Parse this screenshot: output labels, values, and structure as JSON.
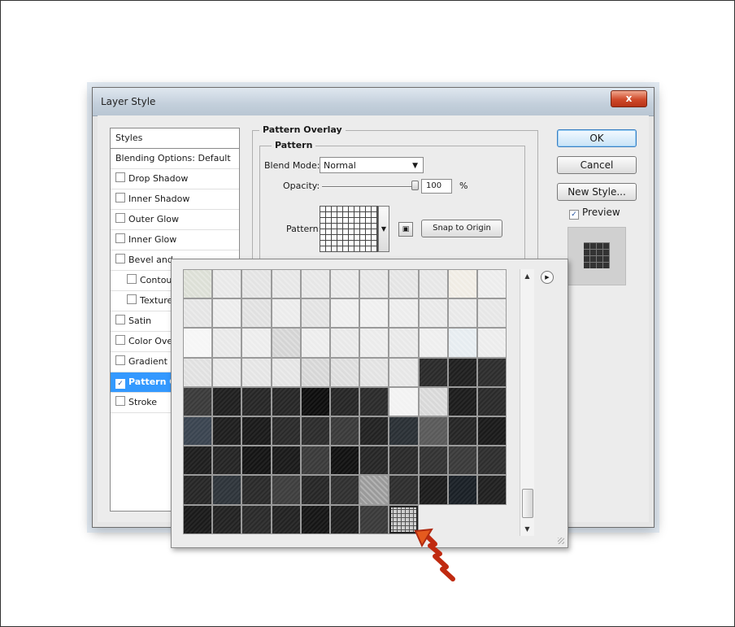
{
  "dialog": {
    "title": "Layer Style",
    "close_label": "x"
  },
  "style_list": {
    "header": "Styles",
    "blending": "Blending Options: Default",
    "items": [
      {
        "label": "Drop Shadow",
        "checked": false,
        "indent": false
      },
      {
        "label": "Inner Shadow",
        "checked": false,
        "indent": false
      },
      {
        "label": "Outer Glow",
        "checked": false,
        "indent": false
      },
      {
        "label": "Inner Glow",
        "checked": false,
        "indent": false
      },
      {
        "label": "Bevel and",
        "checked": false,
        "indent": false
      },
      {
        "label": "Contou",
        "checked": false,
        "indent": true
      },
      {
        "label": "Texture",
        "checked": false,
        "indent": true
      },
      {
        "label": "Satin",
        "checked": false,
        "indent": false
      },
      {
        "label": "Color Ove",
        "checked": false,
        "indent": false
      },
      {
        "label": "Gradient C",
        "checked": false,
        "indent": false
      },
      {
        "label": "Pattern C",
        "checked": true,
        "indent": false,
        "selected": true
      },
      {
        "label": "Stroke",
        "checked": false,
        "indent": false
      }
    ]
  },
  "pattern_overlay": {
    "group_title": "Pattern Overlay",
    "subgroup_title": "Pattern",
    "blend_mode_label": "Blend Mode:",
    "blend_mode_value": "Normal",
    "opacity_label": "Opacity:",
    "opacity_value": "100",
    "opacity_unit": "%",
    "opacity_level": 100,
    "pattern_label": "Pattern:",
    "snap_button": "Snap to Origin"
  },
  "buttons": {
    "ok": "OK",
    "cancel": "Cancel",
    "new_style": "New Style...",
    "preview_label": "Preview",
    "preview_checked": true
  },
  "picker": {
    "rows": [
      [
        "#dcdfd6",
        "#e8e8e8",
        "#e3e3e3",
        "#e6e6e6",
        "#e6e6e6",
        "#e8e8e8",
        "#e6e6e6",
        "#e4e4e4",
        "#e6e6e6",
        "#f0ece4",
        "#ececec"
      ],
      [
        "#e4e4e4",
        "#ececec",
        "#e0e0e0",
        "#ebebeb",
        "#e2e2e2",
        "#eeeeee",
        "#efefef",
        "#ececec",
        "#e8e8e8",
        "#e8e8e8",
        "#e6e6e6"
      ],
      [
        "#f6f6f6",
        "#e8e8e8",
        "#ececec",
        "#d4d4d4",
        "#ececec",
        "#e8e8e8",
        "#ebebeb",
        "#e8e8e8",
        "#eeeeee",
        "#e6ecf0",
        "#ececec"
      ],
      [
        "#e0e0e0",
        "#e6e6e6",
        "#e4e4e4",
        "#e4e4e4",
        "#d6d6d6",
        "#dcdcdc",
        "#e2e2e2",
        "#e6e6e6",
        "#2a2a2a",
        "#1f1f1f",
        "#2d2d2d"
      ],
      [
        "#3a3a3a",
        "#1f1f1f",
        "#262626",
        "#262626",
        "#0d0d0d",
        "#262626",
        "#2b2b2b",
        "#f2f2f2",
        "#d8d8d8",
        "#1c1c1c",
        "#2a2a2a"
      ],
      [
        "#3a4450",
        "#1e1e1e",
        "#1a1a1a",
        "#2a2a2a",
        "#2c2c2c",
        "#3a3a3a",
        "#222222",
        "#2a3035",
        "#5a5a5a",
        "#252525",
        "#1a1a1a"
      ],
      [
        "#1e1e1e",
        "#242424",
        "#141414",
        "#1a1a1a",
        "#3a3a3a",
        "#111111",
        "#262626",
        "#2a2a2a",
        "#333333",
        "#3a3a3a",
        "#2e2e2e"
      ],
      [
        "#262626",
        "#2e343a",
        "#2a2a2a",
        "#3e3e3e",
        "#262626",
        "#303030",
        "#9a9a9a",
        "#2e2e2e",
        "#1c1c1c",
        "#1a2026",
        "#202020"
      ],
      [
        "#1a1a1a",
        "#222222",
        "#2a2a2a",
        "#222222",
        "#151515",
        "#1e1e1e",
        "#3a3a3a",
        "#cfcfcf",
        "",
        "",
        ""
      ]
    ],
    "selected_row": 8,
    "selected_col": 7
  }
}
